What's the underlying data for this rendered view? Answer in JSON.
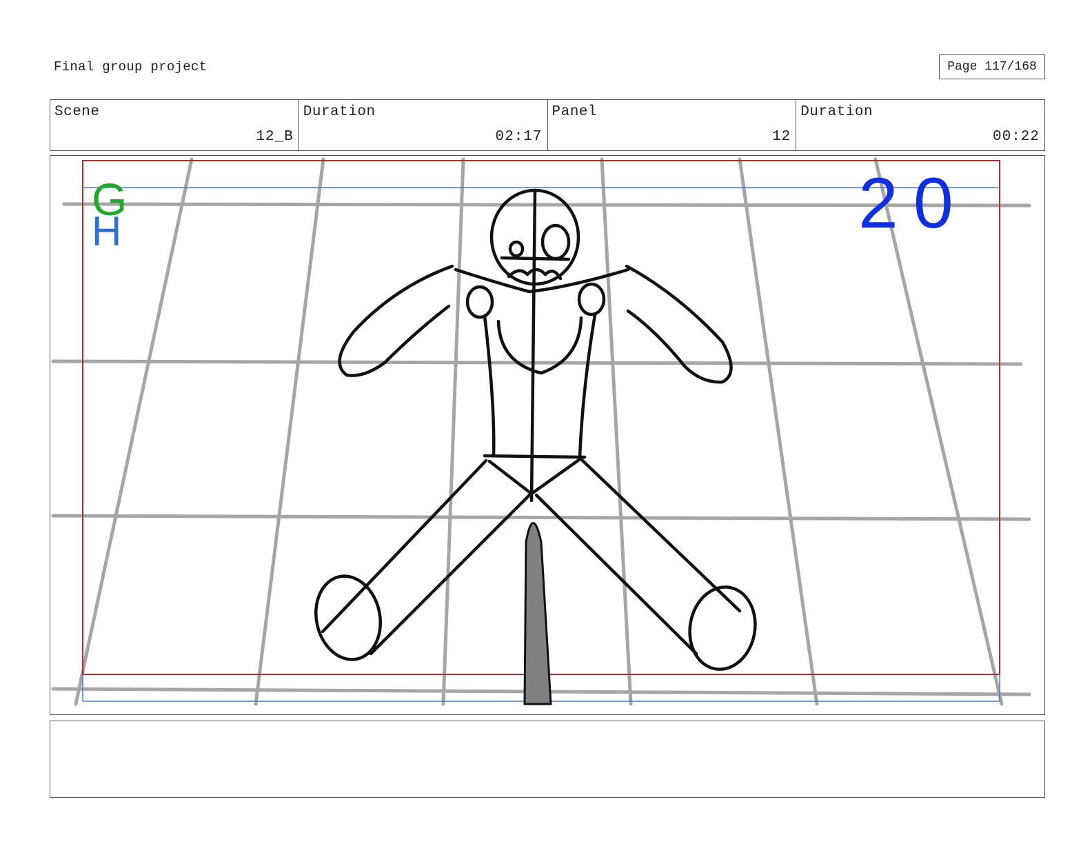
{
  "header": {
    "project_title": "Final group project",
    "page_label": "Page 117/168"
  },
  "info_row": [
    {
      "label": "Scene",
      "value": "12_B"
    },
    {
      "label": "Duration",
      "value": "02:17"
    },
    {
      "label": "Panel",
      "value": "12"
    },
    {
      "label": "Duration",
      "value": "00:22"
    }
  ],
  "panel": {
    "corner_marks": {
      "top": "G",
      "bottom": "H"
    },
    "frame_number": "20",
    "colors": {
      "safe_frame": "#b03030",
      "guide_line": "#4a78c0",
      "grid_line": "#a6a6a6",
      "sketch_line": "#111111",
      "mark_g": "#1faa2a",
      "mark_h": "#2e6fcf",
      "frame_number": "#1030e0",
      "stake_fill": "#808080"
    }
  },
  "notes": {
    "text": ""
  }
}
